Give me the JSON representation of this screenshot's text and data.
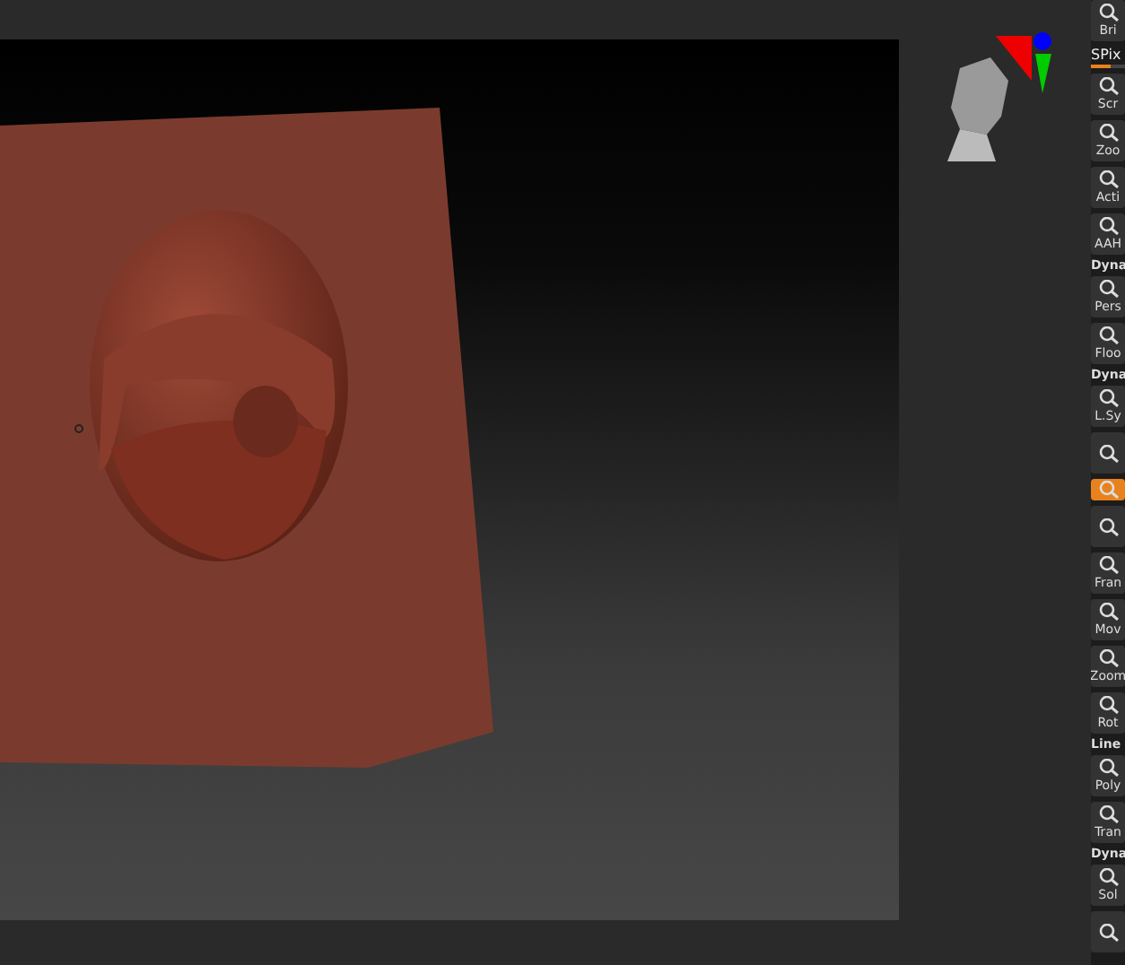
{
  "shelf": [
    {
      "kind": "button",
      "label": "Bri",
      "selected": false
    },
    {
      "kind": "slider",
      "label": "SPix",
      "level": 0.6
    },
    {
      "kind": "button",
      "label": "Scr",
      "selected": false
    },
    {
      "kind": "button",
      "label": "Zoo",
      "selected": false
    },
    {
      "kind": "button",
      "label": "Acti",
      "selected": false
    },
    {
      "kind": "button",
      "label": "AAH",
      "selected": false
    },
    {
      "kind": "header",
      "label": "Dyna"
    },
    {
      "kind": "button",
      "label": "Pers",
      "selected": false
    },
    {
      "kind": "button",
      "label": "Floo",
      "selected": false
    },
    {
      "kind": "header",
      "label": "Dyna"
    },
    {
      "kind": "button",
      "label": "L.Sy",
      "selected": false
    },
    {
      "kind": "button",
      "selected": false
    },
    {
      "kind": "button",
      "selected": true
    },
    {
      "kind": "button",
      "selected": false
    },
    {
      "kind": "button",
      "label": "Fran",
      "selected": false
    },
    {
      "kind": "button",
      "label": "Mov",
      "selected": false
    },
    {
      "kind": "button",
      "label": "Zoom",
      "selected": false
    },
    {
      "kind": "button",
      "label": "Rot",
      "selected": false
    },
    {
      "kind": "header",
      "label": "Line"
    },
    {
      "kind": "button",
      "label": "Poly",
      "selected": false
    },
    {
      "kind": "button",
      "label": "Tran",
      "selected": false
    },
    {
      "kind": "header",
      "label": "Dyna"
    },
    {
      "kind": "button",
      "label": "Sol",
      "selected": false
    },
    {
      "kind": "button",
      "selected": false
    }
  ]
}
